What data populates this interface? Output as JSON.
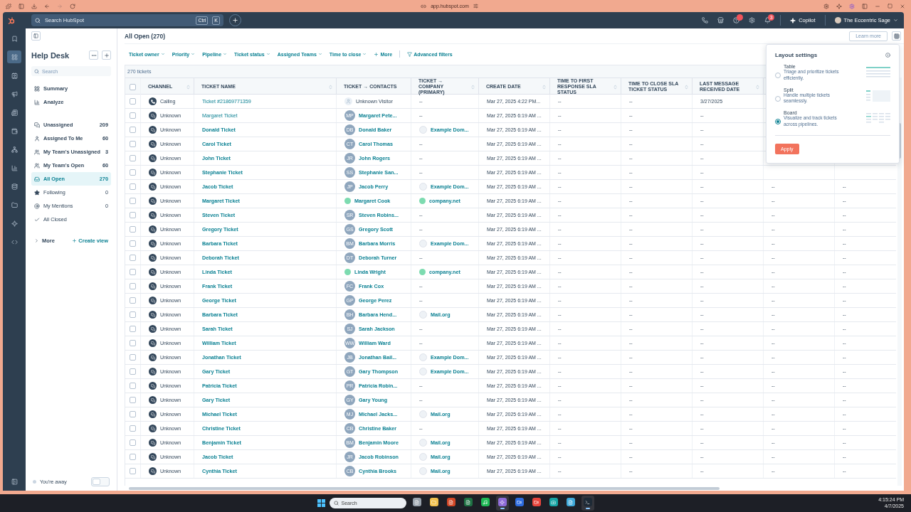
{
  "browser": {
    "url": "app.hubspot.com"
  },
  "topbar": {
    "search": {
      "placeholder": "Search HubSpot"
    },
    "shortcut": [
      "Ctrl",
      "K"
    ],
    "icons": [
      {
        "kind": "phone"
      },
      {
        "kind": "marketplace"
      },
      {
        "kind": "help",
        "badge_dot": true
      },
      {
        "kind": "settings"
      },
      {
        "kind": "bell",
        "badge": "3"
      }
    ],
    "copilot": "Copilot",
    "account": "The Eccentric Sage"
  },
  "rail": [
    {
      "kind": "bookmark",
      "selected": false
    },
    {
      "kind": "grid",
      "selected": true
    },
    {
      "kind": "contacts",
      "selected": false
    },
    {
      "kind": "marketing",
      "selected": false
    },
    {
      "kind": "content",
      "selected": false
    },
    {
      "kind": "commerce",
      "selected": false
    },
    {
      "kind": "automation",
      "selected": false
    },
    {
      "kind": "reports",
      "selected": false
    },
    {
      "kind": "data",
      "selected": false
    },
    {
      "kind": "library",
      "selected": false
    },
    {
      "kind": "breeze",
      "selected": false
    },
    {
      "kind": "dev",
      "selected": false
    }
  ],
  "sidebar": {
    "title": "Help Desk",
    "search": {
      "placeholder": "Search"
    },
    "nav": [
      {
        "kind": "summary",
        "label": "Summary"
      },
      {
        "kind": "analyze",
        "label": "Analyze"
      }
    ],
    "views": [
      {
        "kind": "unassigned",
        "label": "Unassigned",
        "count": "209",
        "emphasis": true,
        "selected": false
      },
      {
        "kind": "mine",
        "label": "Assigned To Me",
        "count": "60",
        "emphasis": true,
        "selected": false
      },
      {
        "kind": "team",
        "label": "My Team's Unassigned",
        "count": "3",
        "emphasis": true,
        "selected": false
      },
      {
        "kind": "team",
        "label": "My Team's Open",
        "count": "60",
        "emphasis": true,
        "selected": false
      },
      {
        "kind": "open",
        "label": "All Open",
        "count": "270",
        "emphasis": true,
        "selected": true
      },
      {
        "kind": "following",
        "label": "Following",
        "count": "0",
        "emphasis": false,
        "selected": false
      },
      {
        "kind": "mentions",
        "label": "My Mentions",
        "count": "0",
        "emphasis": false,
        "selected": false
      },
      {
        "kind": "closed",
        "label": "All Closed",
        "emphasis": false,
        "selected": false
      }
    ],
    "more": "More",
    "create_view": "Create view",
    "away": {
      "label": "You're away",
      "on": false
    }
  },
  "main": {
    "title": "All Open (270)",
    "learn_more": "Learn more",
    "filters": [
      "Ticket owner",
      "Priority",
      "Pipeline",
      "Ticket status",
      "Assigned Teams",
      "Time to close"
    ],
    "more_filters": "More",
    "advanced_filters": "Advanced filters",
    "count": "270 tickets"
  },
  "table": {
    "select_all": {
      "checked": false
    },
    "columns": [
      {
        "label": "CHANNEL",
        "sortable": true
      },
      {
        "label": "TICKET NAME",
        "sortable": true
      },
      {
        "label": "TICKET → CONTACTS",
        "sortable": false
      },
      {
        "label": "TICKET → COMPANY (PRIMARY)",
        "sortable": true
      },
      {
        "label": "CREATE DATE",
        "sortable": true
      },
      {
        "label": "TIME TO FIRST RESPONSE SLA STATUS",
        "sortable": true
      },
      {
        "label": "TIME TO CLOSE SLA TICKET STATUS",
        "sortable": true
      },
      {
        "label": "LAST MESSAGE RECEIVED DATE",
        "sortable": true
      }
    ],
    "rows": [
      {
        "checked": false,
        "channel": {
          "kind": "calling",
          "label": "Calling"
        },
        "name": "Ticket #21869771359",
        "unread": false,
        "contact": {
          "avatar": {
            "kind": "person"
          },
          "name": "Unknown Visitor"
        },
        "company": {
          "name": "--"
        },
        "created": "Mar 27, 2025 4:22 PM...",
        "first_response": "--",
        "close_sla": "--",
        "last_message": "3/27/2025"
      },
      {
        "checked": false,
        "channel": {
          "kind": "unknown",
          "label": "Unknown"
        },
        "name": "Margaret Ticket",
        "unread": false,
        "contact": {
          "avatar": {
            "kind": "initials",
            "text": "MP"
          },
          "name": "Margaret Pete..."
        },
        "company": {
          "name": "--"
        },
        "created": "Mar 27, 2025 6:19 AM ...",
        "first_response": "--",
        "close_sla": "--",
        "last_message": "--"
      },
      {
        "checked": false,
        "channel": {
          "kind": "unknown",
          "label": "Unknown"
        },
        "name": "Donald Ticket",
        "unread": true,
        "contact": {
          "avatar": {
            "kind": "initials",
            "text": "DB"
          },
          "name": "Donald Baker"
        },
        "company": {
          "name": "Example Dom...",
          "logo": {
            "kind": "plain"
          }
        },
        "created": "Mar 27, 2025 6:19 AM ...",
        "first_response": "--",
        "close_sla": "--",
        "last_message": "--"
      },
      {
        "checked": false,
        "channel": {
          "kind": "unknown",
          "label": "Unknown"
        },
        "name": "Carol Ticket",
        "unread": true,
        "contact": {
          "avatar": {
            "kind": "initials",
            "text": "CT"
          },
          "name": "Carol Thomas"
        },
        "company": {
          "name": "--"
        },
        "created": "Mar 27, 2025 6:19 AM ...",
        "first_response": "--",
        "close_sla": "--",
        "last_message": "--"
      },
      {
        "checked": false,
        "channel": {
          "kind": "unknown",
          "label": "Unknown"
        },
        "name": "John Ticket",
        "unread": true,
        "contact": {
          "avatar": {
            "kind": "initials",
            "text": "JR"
          },
          "name": "John Rogers"
        },
        "company": {
          "name": "--"
        },
        "created": "Mar 27, 2025 6:19 AM ...",
        "first_response": "--",
        "close_sla": "--",
        "last_message": "--"
      },
      {
        "checked": false,
        "channel": {
          "kind": "unknown",
          "label": "Unknown"
        },
        "name": "Stephanie Ticket",
        "unread": true,
        "contact": {
          "avatar": {
            "kind": "initials",
            "text": "SS"
          },
          "name": "Stephanie San..."
        },
        "company": {
          "name": "--"
        },
        "created": "Mar 27, 2025 6:19 AM ...",
        "first_response": "--",
        "close_sla": "--",
        "last_message": "--"
      },
      {
        "checked": false,
        "channel": {
          "kind": "unknown",
          "label": "Unknown"
        },
        "name": "Jacob Ticket",
        "unread": true,
        "contact": {
          "avatar": {
            "kind": "initials",
            "text": "JP"
          },
          "name": "Jacob Perry"
        },
        "company": {
          "name": "Example Dom...",
          "logo": {
            "kind": "plain"
          }
        },
        "created": "Mar 27, 2025 6:19 AM ...",
        "first_response": "--",
        "close_sla": "--",
        "last_message": "--",
        "column_10": "--",
        "column_11": "--"
      },
      {
        "checked": false,
        "channel": {
          "kind": "unknown",
          "label": "Unknown"
        },
        "name": "Margaret Ticket",
        "unread": true,
        "contact": {
          "avatar": {
            "kind": "dot",
            "color": "#7ddbb0"
          },
          "name": "Margaret Cook"
        },
        "company": {
          "name": "company.net",
          "logo": {
            "kind": "dot",
            "color": "#7ddbb0"
          }
        },
        "created": "Mar 27, 2025 6:19 AM ...",
        "first_response": "--",
        "close_sla": "--",
        "last_message": "--",
        "column_10": "--",
        "column_11": "--"
      },
      {
        "checked": false,
        "channel": {
          "kind": "unknown",
          "label": "Unknown"
        },
        "name": "Steven Ticket",
        "unread": true,
        "contact": {
          "avatar": {
            "kind": "initials",
            "text": "SR"
          },
          "name": "Steven Robins..."
        },
        "company": {
          "name": "--"
        },
        "created": "Mar 27, 2025 6:19 AM ...",
        "first_response": "--",
        "close_sla": "--",
        "last_message": "--",
        "column_10": "--",
        "column_11": "--"
      },
      {
        "checked": false,
        "channel": {
          "kind": "unknown",
          "label": "Unknown"
        },
        "name": "Gregory Ticket",
        "unread": true,
        "contact": {
          "avatar": {
            "kind": "initials",
            "text": "GS"
          },
          "name": "Gregory Scott"
        },
        "company": {
          "name": "--"
        },
        "created": "Mar 27, 2025 6:19 AM ...",
        "first_response": "--",
        "close_sla": "--",
        "last_message": "--",
        "column_10": "--",
        "column_11": "--"
      },
      {
        "checked": false,
        "channel": {
          "kind": "unknown",
          "label": "Unknown"
        },
        "name": "Barbara Ticket",
        "unread": true,
        "contact": {
          "avatar": {
            "kind": "initials",
            "text": "BM"
          },
          "name": "Barbara Morris"
        },
        "company": {
          "name": "Example Dom...",
          "logo": {
            "kind": "plain"
          }
        },
        "created": "Mar 27, 2025 6:19 AM ...",
        "first_response": "--",
        "close_sla": "--",
        "last_message": "--",
        "column_10": "--",
        "column_11": "--"
      },
      {
        "checked": false,
        "channel": {
          "kind": "unknown",
          "label": "Unknown"
        },
        "name": "Deborah Ticket",
        "unread": true,
        "contact": {
          "avatar": {
            "kind": "initials",
            "text": "DT"
          },
          "name": "Deborah Turner"
        },
        "company": {
          "name": "--"
        },
        "created": "Mar 27, 2025 6:19 AM ...",
        "first_response": "--",
        "close_sla": "--",
        "last_message": "--",
        "column_10": "--",
        "column_11": "--"
      },
      {
        "checked": false,
        "channel": {
          "kind": "unknown",
          "label": "Unknown"
        },
        "name": "Linda Ticket",
        "unread": true,
        "contact": {
          "avatar": {
            "kind": "dot",
            "color": "#7ddbb0"
          },
          "name": "Linda Wright"
        },
        "company": {
          "name": "company.net",
          "logo": {
            "kind": "dot",
            "color": "#7ddbb0"
          }
        },
        "created": "Mar 27, 2025 6:19 AM ...",
        "first_response": "--",
        "close_sla": "--",
        "last_message": "--",
        "column_10": "--",
        "column_11": "--"
      },
      {
        "checked": false,
        "channel": {
          "kind": "unknown",
          "label": "Unknown"
        },
        "name": "Frank Ticket",
        "unread": true,
        "contact": {
          "avatar": {
            "kind": "initials",
            "text": "FC"
          },
          "name": "Frank Cox"
        },
        "company": {
          "name": "--"
        },
        "created": "Mar 27, 2025 6:19 AM ...",
        "first_response": "--",
        "close_sla": "--",
        "last_message": "--",
        "column_10": "--",
        "column_11": "--"
      },
      {
        "checked": false,
        "channel": {
          "kind": "unknown",
          "label": "Unknown"
        },
        "name": "George Ticket",
        "unread": true,
        "contact": {
          "avatar": {
            "kind": "initials",
            "text": "GP"
          },
          "name": "George Perez"
        },
        "company": {
          "name": "--"
        },
        "created": "Mar 27, 2025 6:19 AM ...",
        "first_response": "--",
        "close_sla": "--",
        "last_message": "--",
        "column_10": "--",
        "column_11": "--"
      },
      {
        "checked": false,
        "channel": {
          "kind": "unknown",
          "label": "Unknown"
        },
        "name": "Barbara Ticket",
        "unread": true,
        "contact": {
          "avatar": {
            "kind": "initials",
            "text": "BH"
          },
          "name": "Barbara Hend..."
        },
        "company": {
          "name": "Mail.org",
          "logo": {
            "kind": "plain"
          }
        },
        "created": "Mar 27, 2025 6:19 AM ...",
        "first_response": "--",
        "close_sla": "--",
        "last_message": "--",
        "column_10": "--",
        "column_11": "--"
      },
      {
        "checked": false,
        "channel": {
          "kind": "unknown",
          "label": "Unknown"
        },
        "name": "Sarah Ticket",
        "unread": true,
        "contact": {
          "avatar": {
            "kind": "initials",
            "text": "SJ"
          },
          "name": "Sarah Jackson"
        },
        "company": {
          "name": "--"
        },
        "created": "Mar 27, 2025 6:19 AM ...",
        "first_response": "--",
        "close_sla": "--",
        "last_message": "--",
        "column_10": "--",
        "column_11": "--"
      },
      {
        "checked": false,
        "channel": {
          "kind": "unknown",
          "label": "Unknown"
        },
        "name": "William Ticket",
        "unread": true,
        "contact": {
          "avatar": {
            "kind": "initials",
            "text": "WW"
          },
          "name": "William Ward"
        },
        "company": {
          "name": "--"
        },
        "created": "Mar 27, 2025 6:19 AM ...",
        "first_response": "--",
        "close_sla": "--",
        "last_message": "--",
        "column_10": "--",
        "column_11": "--"
      },
      {
        "checked": false,
        "channel": {
          "kind": "unknown",
          "label": "Unknown"
        },
        "name": "Jonathan Ticket",
        "unread": true,
        "contact": {
          "avatar": {
            "kind": "initials",
            "text": "JB"
          },
          "name": "Jonathan Bail..."
        },
        "company": {
          "name": "Example Dom...",
          "logo": {
            "kind": "plain"
          }
        },
        "created": "Mar 27, 2025 6:19 AM ...",
        "first_response": "--",
        "close_sla": "--",
        "last_message": "--",
        "column_10": "--",
        "column_11": "--"
      },
      {
        "checked": false,
        "channel": {
          "kind": "unknown",
          "label": "Unknown"
        },
        "name": "Gary Ticket",
        "unread": true,
        "contact": {
          "avatar": {
            "kind": "initials",
            "text": "GT"
          },
          "name": "Gary Thompson"
        },
        "company": {
          "name": "Example Dom...",
          "logo": {
            "kind": "plain"
          }
        },
        "created": "Mar 27, 2025 6:19 AM ...",
        "first_response": "--",
        "close_sla": "--",
        "last_message": "--",
        "column_10": "--",
        "column_11": "--"
      },
      {
        "checked": false,
        "channel": {
          "kind": "unknown",
          "label": "Unknown"
        },
        "name": "Patricia Ticket",
        "unread": true,
        "contact": {
          "avatar": {
            "kind": "initials",
            "text": "PR"
          },
          "name": "Patricia Robin..."
        },
        "company": {
          "name": "--"
        },
        "created": "Mar 27, 2025 6:19 AM ...",
        "first_response": "--",
        "close_sla": "--",
        "last_message": "--",
        "column_10": "--",
        "column_11": "--"
      },
      {
        "checked": false,
        "channel": {
          "kind": "unknown",
          "label": "Unknown"
        },
        "name": "Gary Ticket",
        "unread": true,
        "contact": {
          "avatar": {
            "kind": "initials",
            "text": "GY"
          },
          "name": "Gary Young"
        },
        "company": {
          "name": "--"
        },
        "created": "Mar 27, 2025 6:19 AM ...",
        "first_response": "--",
        "close_sla": "--",
        "last_message": "--",
        "column_10": "--",
        "column_11": "--"
      },
      {
        "checked": false,
        "channel": {
          "kind": "unknown",
          "label": "Unknown"
        },
        "name": "Michael Ticket",
        "unread": true,
        "contact": {
          "avatar": {
            "kind": "initials",
            "text": "MJ"
          },
          "name": "Michael Jacks..."
        },
        "company": {
          "name": "Mail.org",
          "logo": {
            "kind": "plain"
          }
        },
        "created": "Mar 27, 2025 6:19 AM ...",
        "first_response": "--",
        "close_sla": "--",
        "last_message": "--",
        "column_10": "--",
        "column_11": "--"
      },
      {
        "checked": false,
        "channel": {
          "kind": "unknown",
          "label": "Unknown"
        },
        "name": "Christine Ticket",
        "unread": true,
        "contact": {
          "avatar": {
            "kind": "initials",
            "text": "CB"
          },
          "name": "Christine Baker"
        },
        "company": {
          "name": "--"
        },
        "created": "Mar 27, 2025 6:19 AM ...",
        "first_response": "--",
        "close_sla": "--",
        "last_message": "--",
        "column_10": "--",
        "column_11": "--"
      },
      {
        "checked": false,
        "channel": {
          "kind": "unknown",
          "label": "Unknown"
        },
        "name": "Benjamin Ticket",
        "unread": true,
        "contact": {
          "avatar": {
            "kind": "initials",
            "text": "BM"
          },
          "name": "Benjamin Moore"
        },
        "company": {
          "name": "Mail.org",
          "logo": {
            "kind": "plain"
          }
        },
        "created": "Mar 27, 2025 6:19 AM ...",
        "first_response": "--",
        "close_sla": "--",
        "last_message": "--",
        "column_10": "--",
        "column_11": "--"
      },
      {
        "checked": false,
        "channel": {
          "kind": "unknown",
          "label": "Unknown"
        },
        "name": "Jacob Ticket",
        "unread": true,
        "contact": {
          "avatar": {
            "kind": "initials",
            "text": "JR"
          },
          "name": "Jacob Robinson"
        },
        "company": {
          "name": "Mail.org",
          "logo": {
            "kind": "plain"
          }
        },
        "created": "Mar 27, 2025 6:19 AM ...",
        "first_response": "--",
        "close_sla": "--",
        "last_message": "--",
        "column_10": "--",
        "column_11": "--"
      },
      {
        "checked": false,
        "channel": {
          "kind": "unknown",
          "label": "Unknown"
        },
        "name": "Cynthia Ticket",
        "unread": true,
        "contact": {
          "avatar": {
            "kind": "initials",
            "text": "CB"
          },
          "name": "Cynthia Brooks"
        },
        "company": {
          "name": "Mail.org",
          "logo": {
            "kind": "plain"
          }
        },
        "created": "Mar 27, 2025 6:19 AM ...",
        "first_response": "--",
        "close_sla": "--",
        "last_message": "--",
        "column_10": "--",
        "column_11": "--"
      }
    ]
  },
  "layout_settings": {
    "title": "Layout settings",
    "options": [
      {
        "kind": "table",
        "title": "Table",
        "description": "Triage and prioritize tickets efficiently.",
        "selected": false
      },
      {
        "kind": "split",
        "title": "Split",
        "description": "Handle multiple tickets seamlessly.",
        "selected": false
      },
      {
        "kind": "board",
        "title": "Board",
        "description": "Visualize and track tickets across pipelines.",
        "selected": true
      }
    ],
    "apply": "Apply"
  },
  "taskbar": {
    "search": {
      "placeholder": "Search"
    },
    "apps": [
      {
        "kind": "files",
        "color": "#9aa3ad",
        "active": false
      },
      {
        "kind": "folder",
        "color": "#f2c14e",
        "active": false
      },
      {
        "kind": "doc",
        "color": "#d24726",
        "active": false
      },
      {
        "kind": "doc",
        "color": "#1f7244",
        "active": false
      },
      {
        "kind": "music",
        "color": "#1db954",
        "active": false
      },
      {
        "kind": "star",
        "color": "#8e6bd8",
        "active": true
      },
      {
        "kind": "round",
        "color": "#2d6cdf",
        "active": false
      },
      {
        "kind": "round",
        "color": "#e8453c",
        "active": false
      },
      {
        "kind": "camera",
        "color": "#16a5a5",
        "active": false
      },
      {
        "kind": "doc",
        "color": "#3fa9d9",
        "active": false
      },
      {
        "kind": "terminal",
        "color": "#1e2a36",
        "active": true
      }
    ],
    "time": "4:15:24 PM",
    "date": "4/7/2025"
  }
}
